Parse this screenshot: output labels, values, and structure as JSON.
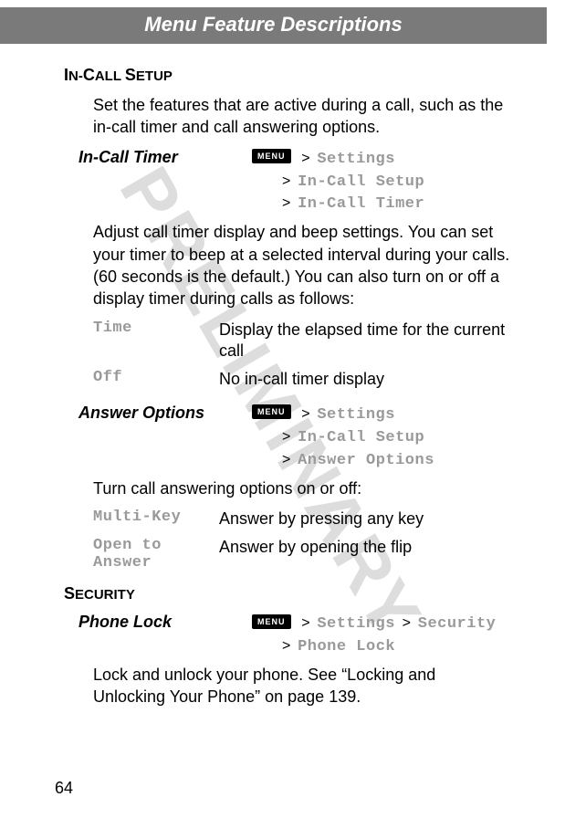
{
  "header": "Menu Feature Descriptions",
  "watermark": "PRELIMINARY",
  "pageNumber": "64",
  "section1": {
    "heading_pre": "I",
    "heading_mid": "N-",
    "heading_cap2": "C",
    "heading_rest": "ALL ",
    "heading_cap3": "S",
    "heading_end": "ETUP",
    "intro": "Set the features that are active during a call, such as the in-call timer and call answering options.",
    "feature1": {
      "label": "In-Call Timer",
      "menu": "MENU",
      "path1": "Settings",
      "path2": "In-Call Setup",
      "path3": "In-Call Timer",
      "desc": "Adjust call timer display and beep settings. You can set your timer to beep at a selected interval during your calls. (60 seconds is the default.) You can also turn on or off a display timer during calls as follows:",
      "opt1_label": "Time",
      "opt1_desc": "Display the elapsed time for the current call",
      "opt2_label": "Off",
      "opt2_desc": "No in-call timer display"
    },
    "feature2": {
      "label": "Answer Options",
      "menu": "MENU",
      "path1": "Settings",
      "path2": "In-Call Setup",
      "path3": "Answer Options",
      "desc": "Turn call answering options on or off:",
      "opt1_label": "Multi-Key",
      "opt1_desc": "Answer by pressing any key",
      "opt2_label": "Open to Answer",
      "opt2_desc": "Answer by opening the flip"
    }
  },
  "section2": {
    "heading_cap": "S",
    "heading_rest": "ECURITY",
    "feature1": {
      "label": "Phone Lock",
      "menu": "MENU",
      "path1": "Settings",
      "path2": "Security",
      "path3": "Phone Lock",
      "desc": "Lock and unlock your phone. See “Locking and Unlocking Your Phone” on page 139."
    }
  }
}
